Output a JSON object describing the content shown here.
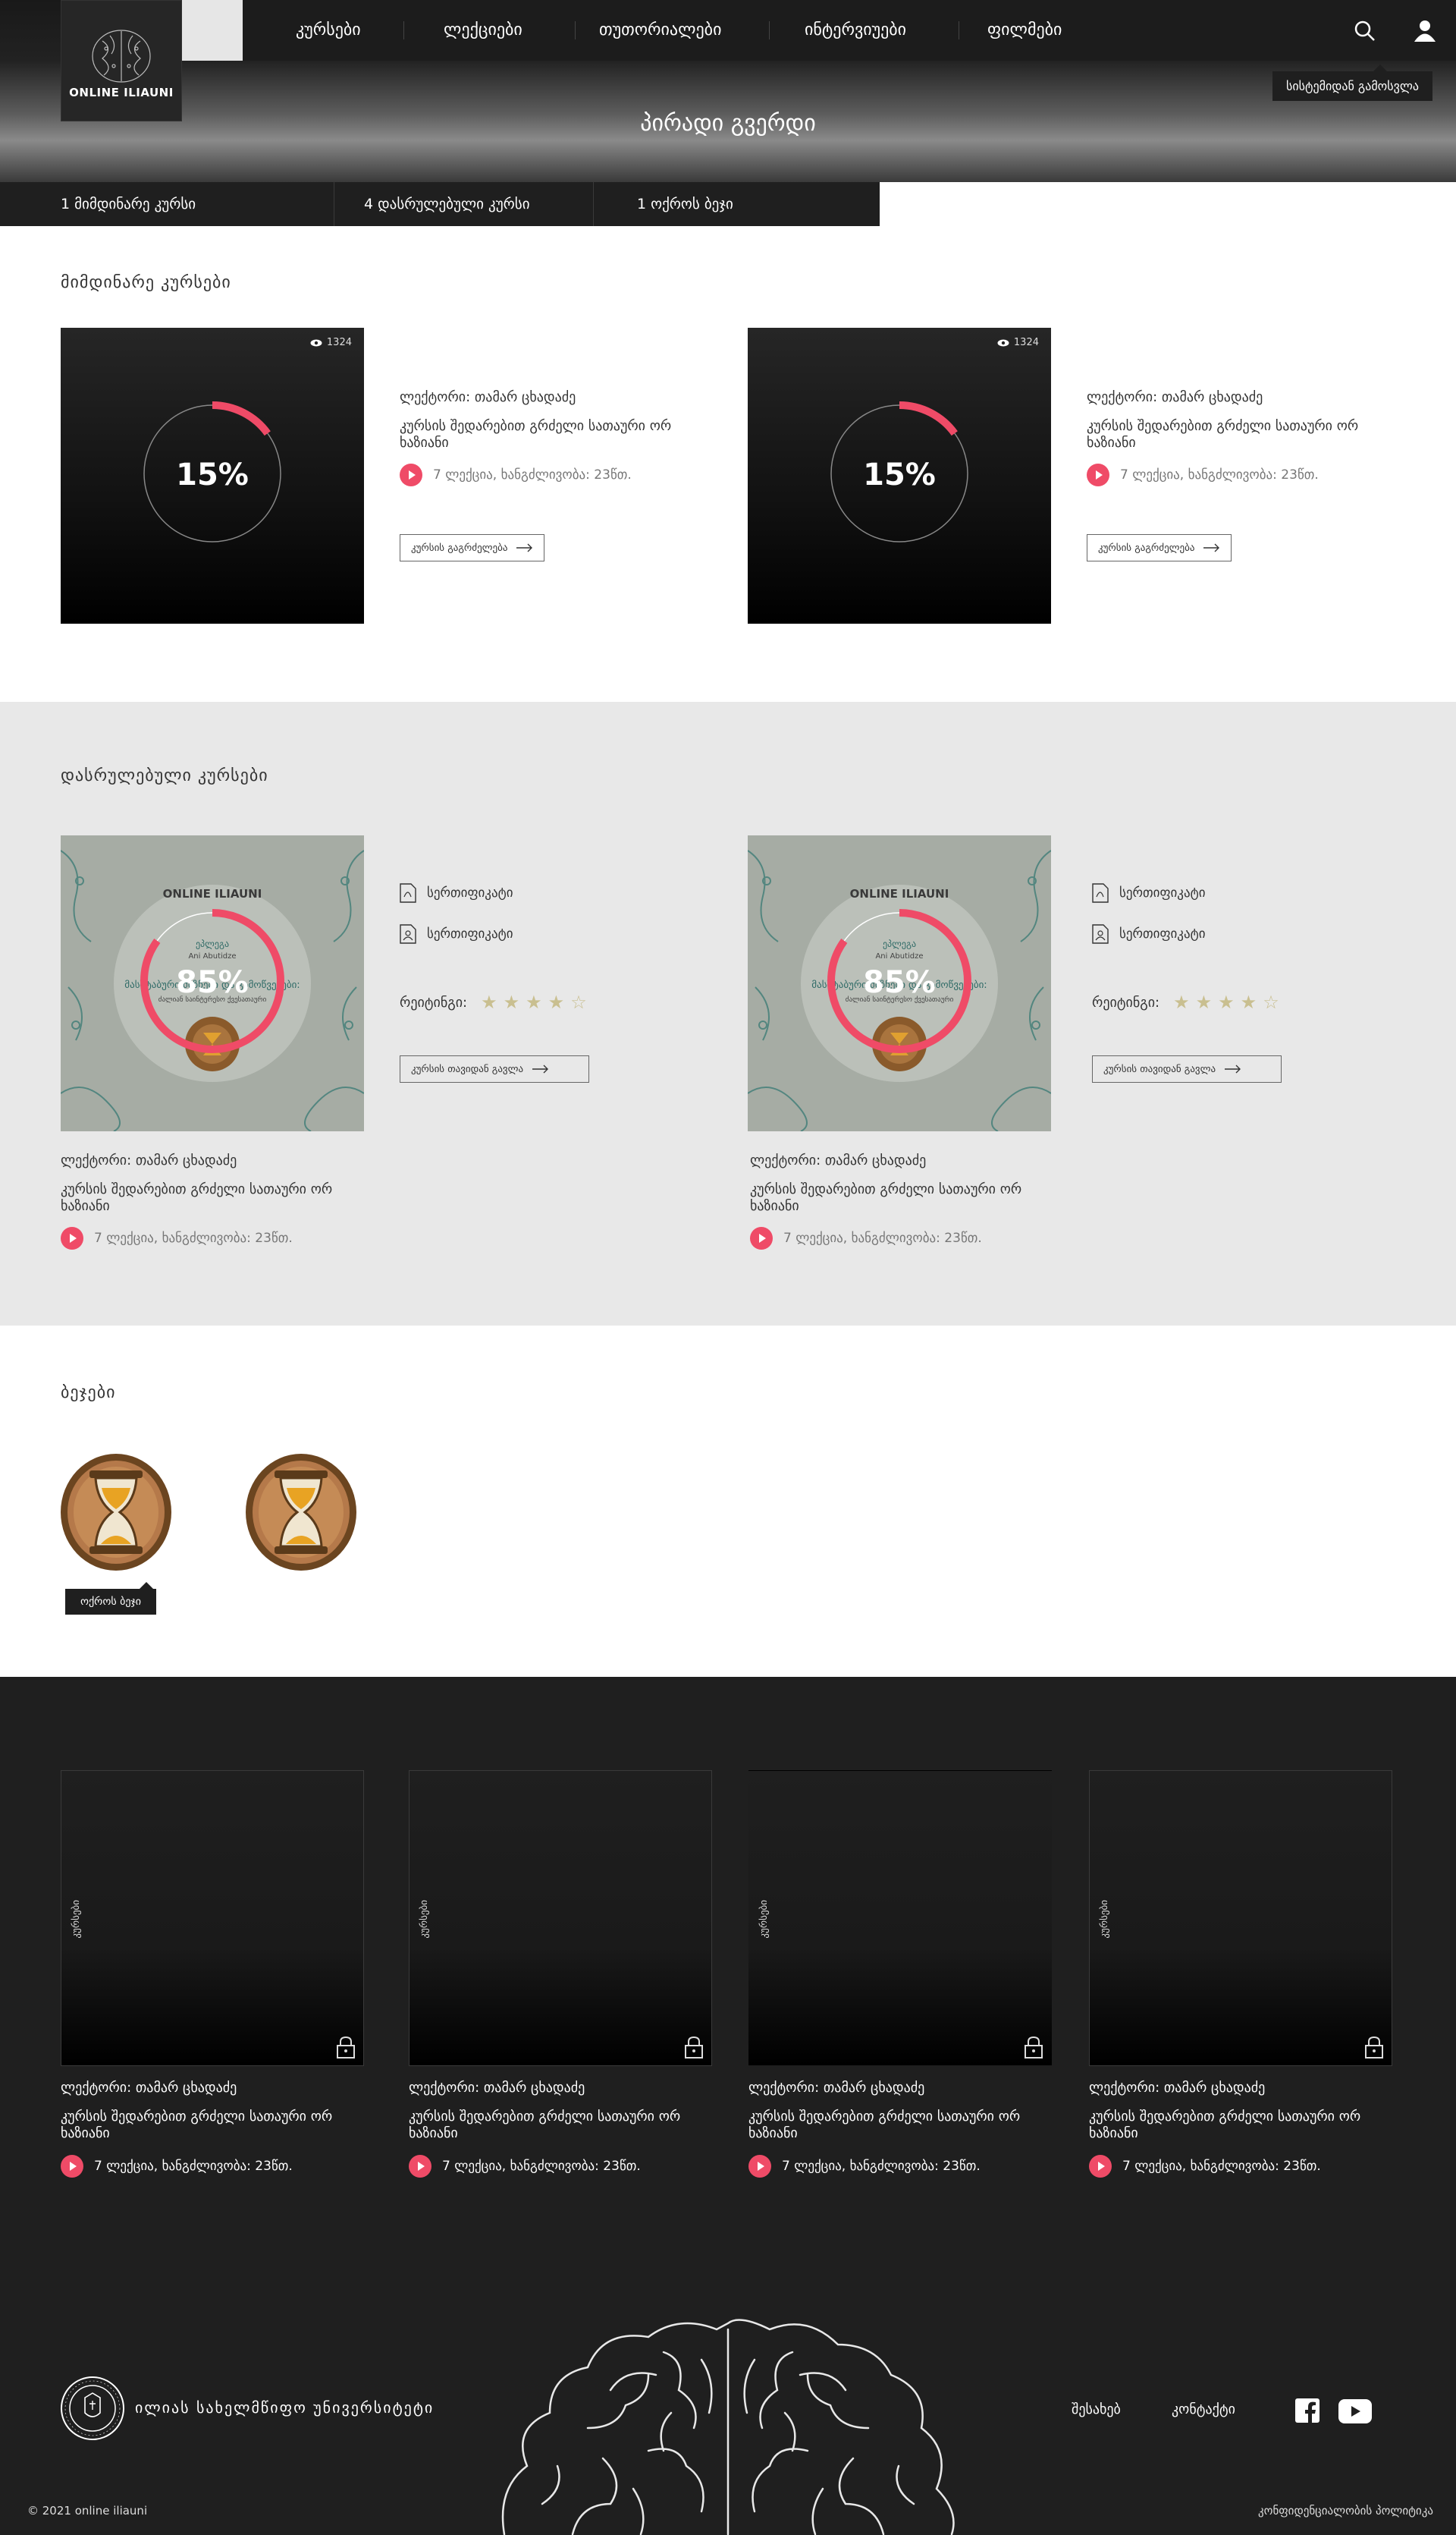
{
  "header": {
    "logo_text": "ONLINE ILIAUNI",
    "nav": [
      "კურსები",
      "ლექციები",
      "თუთორიალები",
      "ინტერვიუები",
      "ფილმები"
    ],
    "page_title": "პირადი გვერდი",
    "logout_tooltip": "სისტემიდან გამოსვლა"
  },
  "stats": [
    "1 მიმდინარე კურსი",
    "4 დასრულებული კურსი",
    "1 ოქროს ბეჯი"
  ],
  "current": {
    "title": "მიმდინარე კურსები",
    "cards": [
      {
        "views": "1324",
        "progress_label": "15%",
        "progress": 0.15,
        "lecturer": "ლექტორი: თამარ ცხადაძე",
        "course_title": "კურსის შედარებით გრძელი სათაური ორ ხაზიანი",
        "meta": "7 ლექცია, ხანგძლივობა: 23წთ.",
        "button": "კურსის გაგრძელება"
      },
      {
        "views": "1324",
        "progress_label": "15%",
        "progress": 0.15,
        "lecturer": "ლექტორი: თამარ ცხადაძე",
        "course_title": "კურსის შედარებით გრძელი სათაური ორ ხაზიანი",
        "meta": "7 ლექცია, ხანგძლივობა: 23წთ.",
        "button": "კურსის გაგრძელება"
      }
    ]
  },
  "finished": {
    "title": "დასრულებული კურსები",
    "cards": [
      {
        "progress_label": "85%",
        "progress": 0.85,
        "cert_logo": "ONLINE ILIAUNI",
        "cert_word": "ეპლეგა",
        "cert_name": "Ani Abutidze",
        "cert_course": "მასშტაბური მიზნები და გამოწვევები:",
        "cert_sub": "ძალიან საინტერესო ქვესათაური",
        "certificates": [
          "სერთიფიკატი",
          "სერთიფიკატი"
        ],
        "rating_label": "რეიტინგი:",
        "rating": 4,
        "rating_max": 5,
        "button": "კურსის თავიდან გავლა",
        "lecturer": "ლექტორი: თამარ ცხადაძე",
        "course_title": "კურსის შედარებით გრძელი სათაური ორ ხაზიანი",
        "meta": "7 ლექცია, ხანგძლივობა: 23წთ."
      },
      {
        "progress_label": "85%",
        "progress": 0.85,
        "cert_logo": "ONLINE ILIAUNI",
        "cert_word": "ეპლეგა",
        "cert_name": "Ani Abutidze",
        "cert_course": "მასშტაბური მიზნები და გამოწვევები:",
        "cert_sub": "ძალიან საინტერესო ქვესათაური",
        "certificates": [
          "სერთიფიკატი",
          "სერთიფიკატი"
        ],
        "rating_label": "რეიტინგი:",
        "rating": 4,
        "rating_max": 5,
        "button": "კურსის თავიდან გავლა",
        "lecturer": "ლექტორი: თამარ ცხადაძე",
        "course_title": "კურსის შედარებით გრძელი სათაური ორ ხაზიანი",
        "meta": "7 ლექცია, ხანგძლივობა: 23წთ."
      }
    ]
  },
  "badges": {
    "title": "ბეჯები",
    "tooltip": "ოქროს ბეჯი"
  },
  "locked": {
    "cards": [
      {
        "vertical": "კურსები",
        "lecturer": "ლექტორი: თამარ ცხადაძე",
        "course_title": "კურსის შედარებით გრძელი სათაური ორ ხაზიანი",
        "meta": "7 ლექცია, ხანგძლივობა: 23წთ."
      },
      {
        "vertical": "კურსები",
        "lecturer": "ლექტორი: თამარ ცხადაძე",
        "course_title": "კურსის შედარებით გრძელი სათაური ორ ხაზიანი",
        "meta": "7 ლექცია, ხანგძლივობა: 23წთ."
      },
      {
        "vertical": "კურსები",
        "lecturer": "ლექტორი: თამარ ცხადაძე",
        "course_title": "კურსის შედარებით გრძელი სათაური ორ ხაზიანი",
        "meta": "7 ლექცია, ხანგძლივობა: 23წთ."
      },
      {
        "vertical": "კურსები",
        "lecturer": "ლექტორი: თამარ ცხადაძე",
        "course_title": "კურსის შედარებით გრძელი სათაური ორ ხაზიანი",
        "meta": "7 ლექცია, ხანგძლივობა: 23წთ."
      }
    ]
  },
  "footer": {
    "university": "ილიას სახელმწიფო უნივერსიტეტი",
    "about": "შესახებ",
    "contact": "კონტაქტი",
    "copyright": "©  2021 online iliauni",
    "privacy": "კონფიდენციალობის პოლიტიკა"
  },
  "colors": {
    "accent": "#ef4b67",
    "dark": "#1f1f1f",
    "star": "#c9bf90"
  }
}
